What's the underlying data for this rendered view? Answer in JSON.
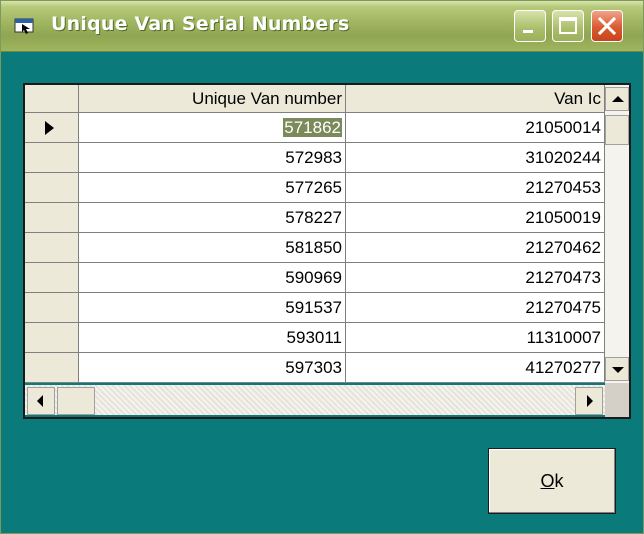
{
  "window": {
    "title": "Unique Van Serial Numbers",
    "title_icon": "app-window-icon",
    "controls": [
      "minimize-icon",
      "maximize-icon",
      "close-icon"
    ]
  },
  "grid": {
    "columns": [
      "Unique Van number",
      "Van Ic"
    ],
    "rows": [
      [
        "571862",
        "21050014"
      ],
      [
        "572983",
        "31020244"
      ],
      [
        "577265",
        "21270453"
      ],
      [
        "578227",
        "21050019"
      ],
      [
        "581850",
        "21270462"
      ],
      [
        "590969",
        "21270473"
      ],
      [
        "591537",
        "21270475"
      ],
      [
        "593011",
        "11310007"
      ],
      [
        "597303",
        "41270277"
      ]
    ],
    "current_row_indicator": "row-pointer-icon"
  },
  "buttons": {
    "ok_mnemonic": "O",
    "ok_rest": "k"
  },
  "colors": {
    "window_background": "#0a7a7a",
    "titlebar": "#9fb45e",
    "selected_cell": "#7a8a5a"
  }
}
